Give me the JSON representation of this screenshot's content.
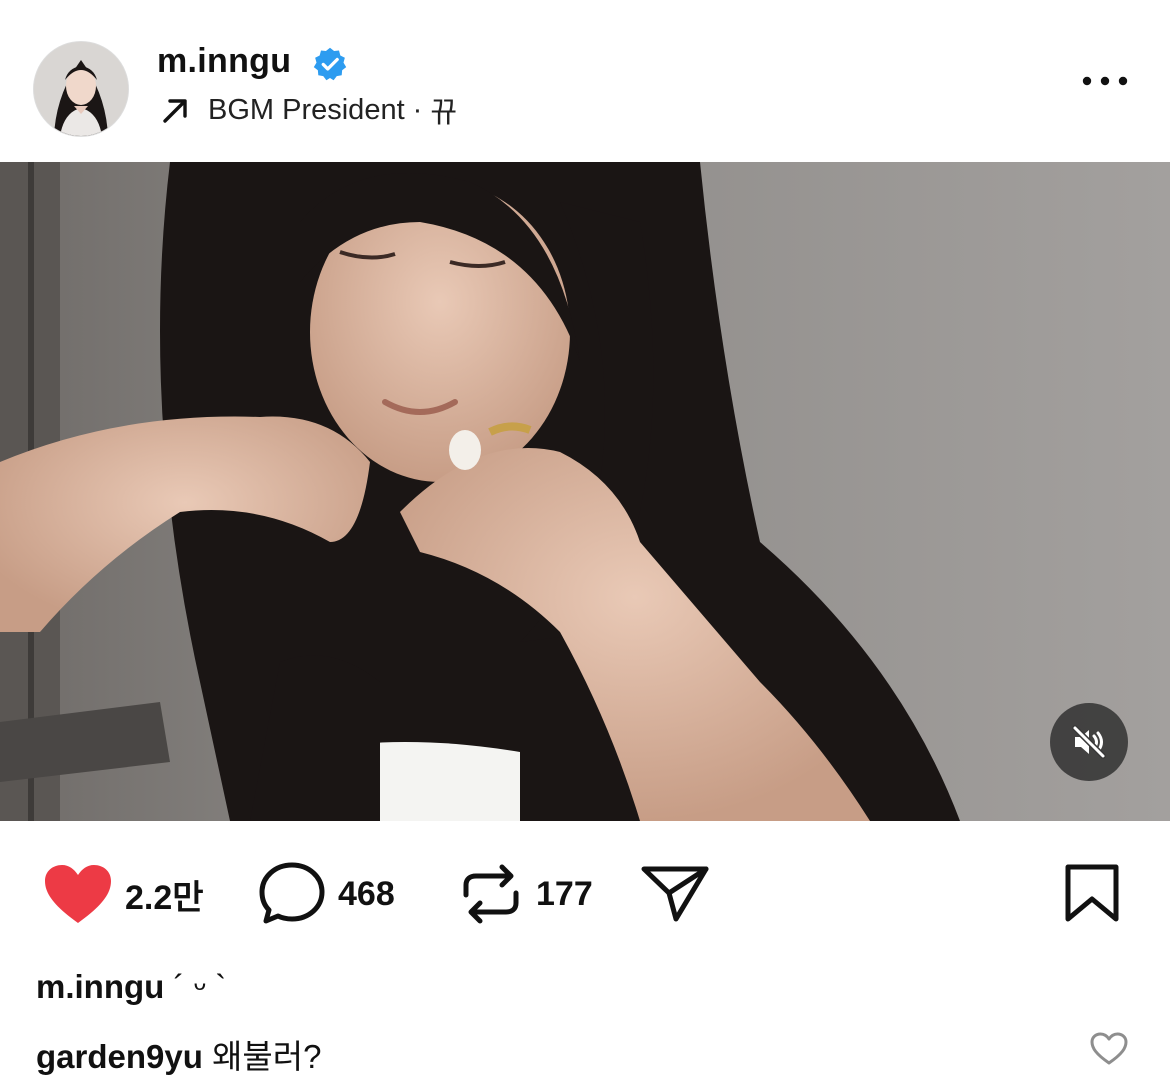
{
  "post": {
    "username": "m.inngu",
    "verified": true,
    "music_artist": "BGM President",
    "music_separator": "·",
    "music_title": "뀨"
  },
  "media": {
    "muted": true
  },
  "actions": {
    "likes": "2.2만",
    "comments": "468",
    "reposts": "177",
    "like_color": "#ed3a45"
  },
  "caption": {
    "username": "m.inngu",
    "text": "´ ᵕ `"
  },
  "comment": {
    "username": "garden9yu",
    "text": "왜불러?"
  }
}
